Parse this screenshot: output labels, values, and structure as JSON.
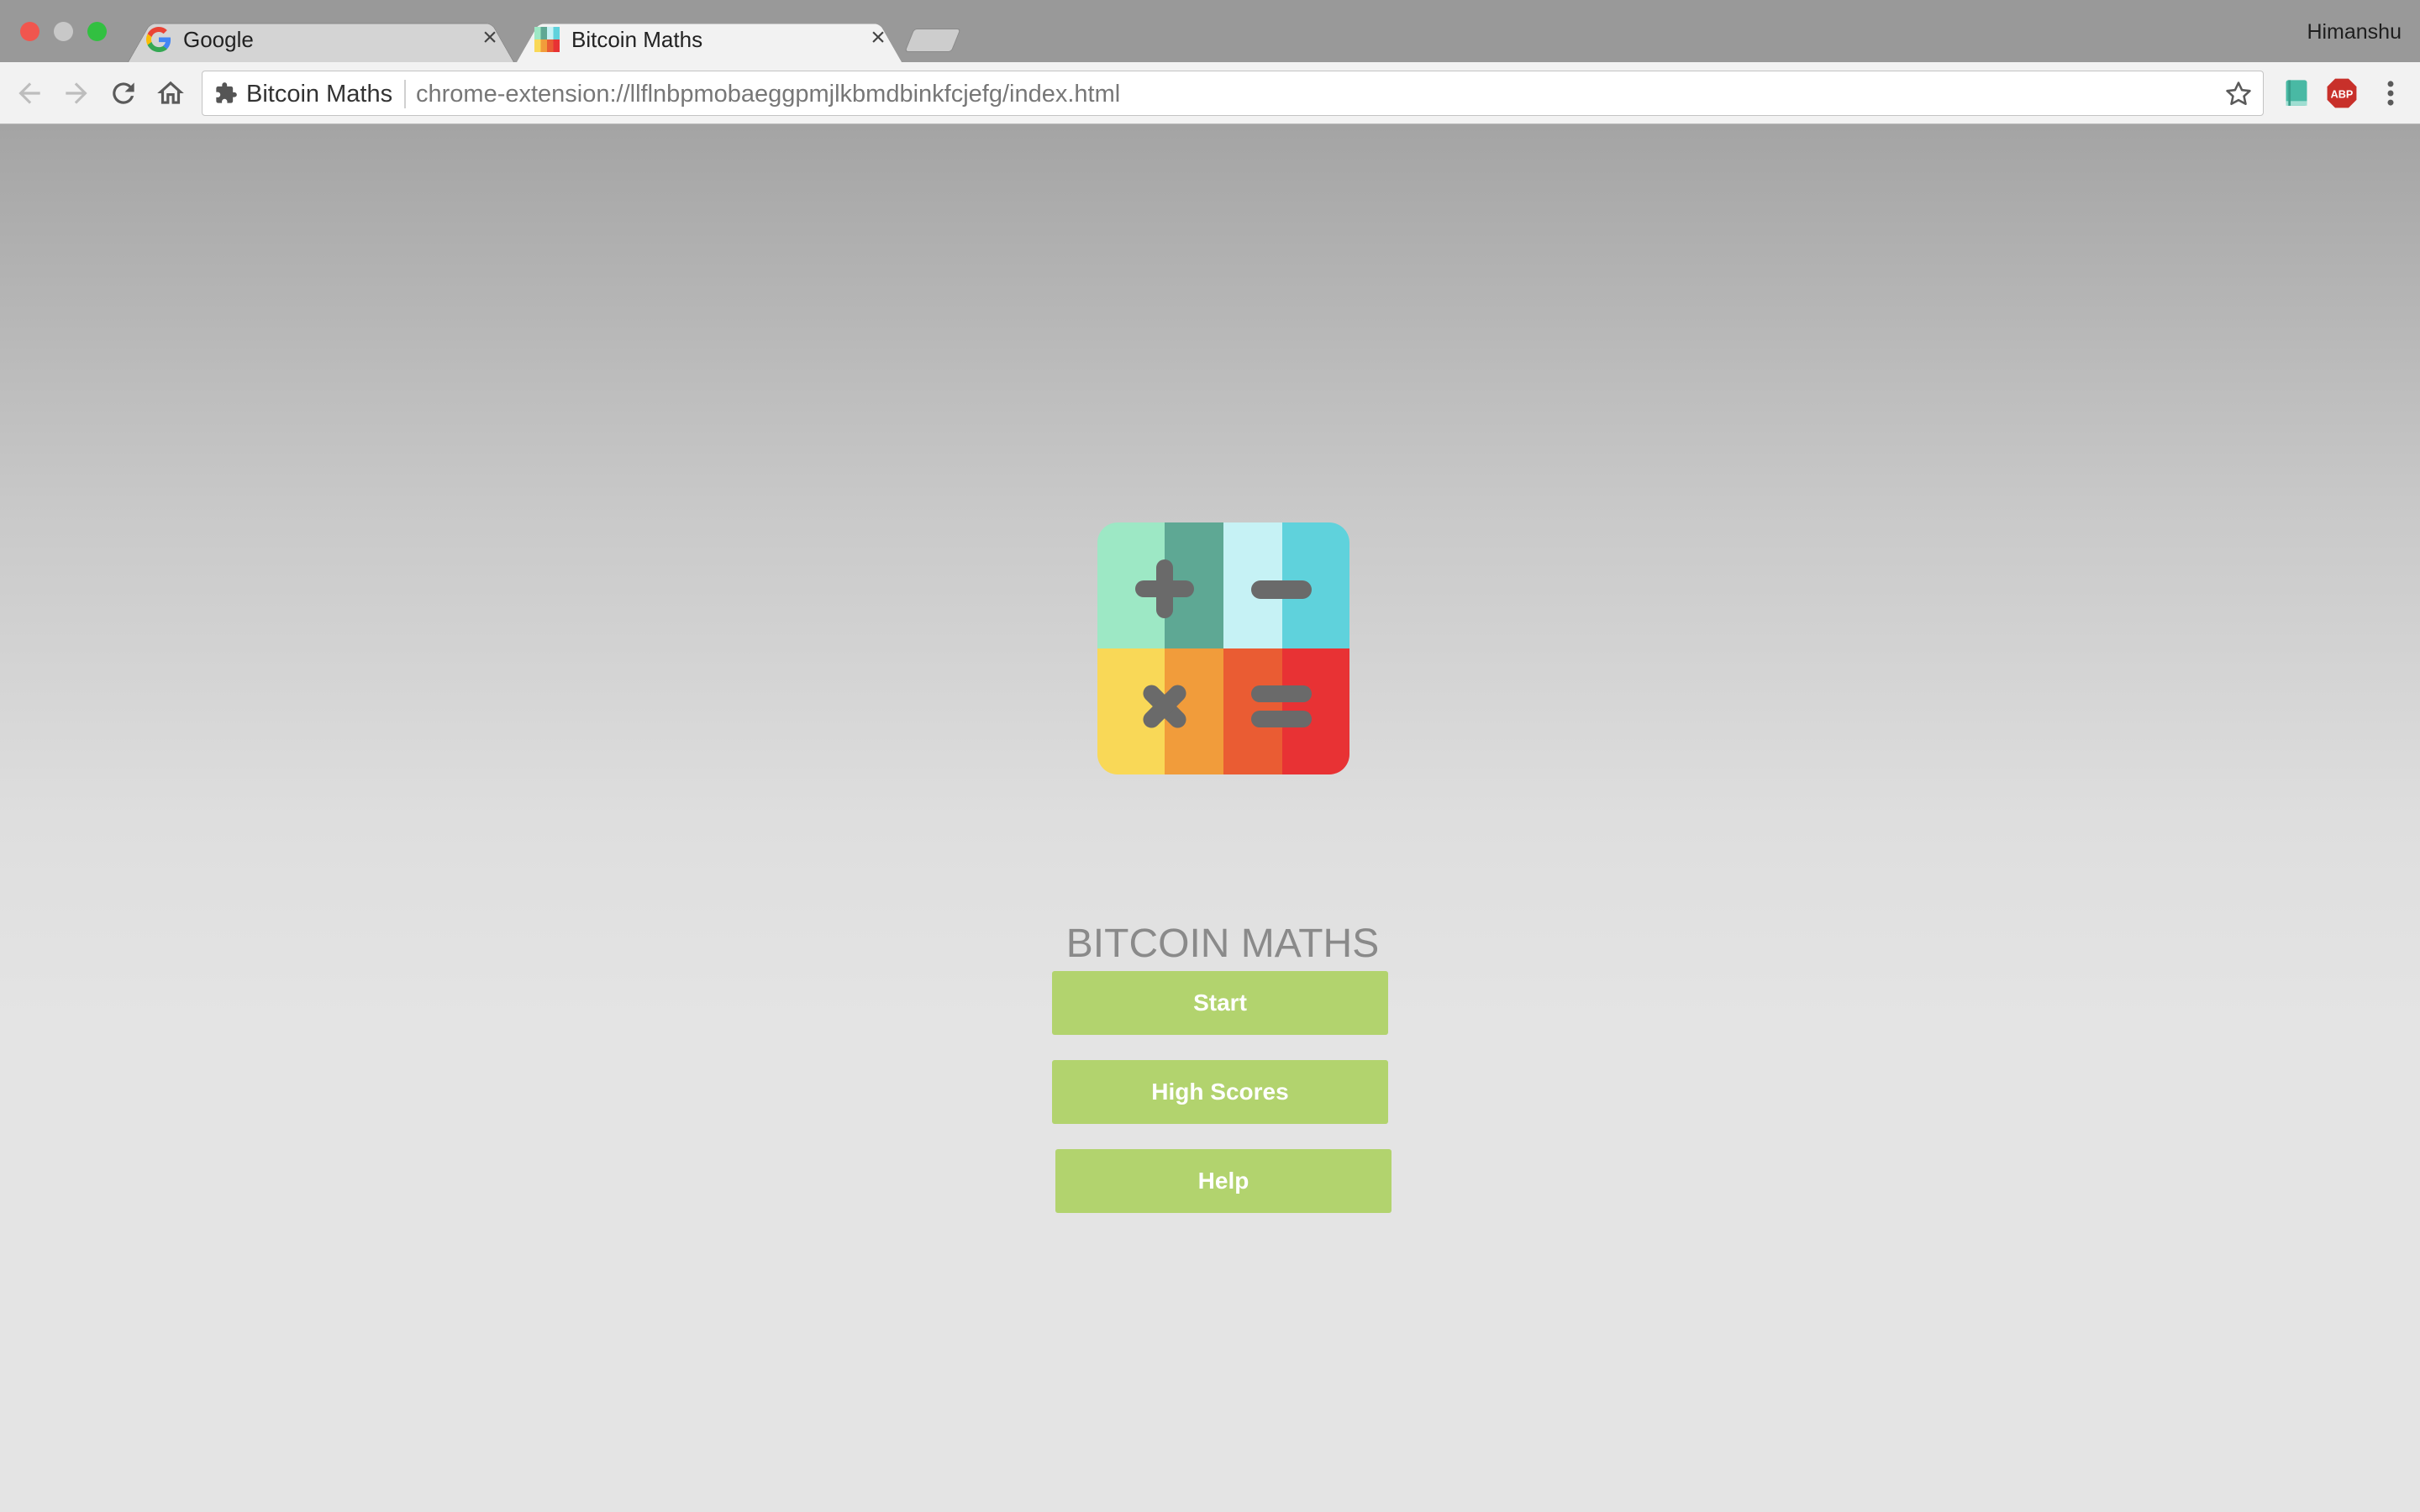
{
  "browser": {
    "profile_name": "Himanshu",
    "tabs": [
      {
        "title": "Google",
        "icon": "google-g-icon",
        "active": false
      },
      {
        "title": "Bitcoin Maths",
        "icon": "calculator-favicon",
        "active": true
      }
    ],
    "close_glyph": "×",
    "omnibox": {
      "site_label": "Bitcoin Maths",
      "url": "chrome-extension://llflnbpmobaeggpmjlkbmdbinkfcjefg/index.html"
    }
  },
  "app": {
    "title": "BITCOIN MATHS",
    "buttons": {
      "start": "Start",
      "high_scores": "High Scores",
      "help": "Help"
    },
    "logo_colors": {
      "plus_light": "#9de8c5",
      "plus_dark": "#5ea894",
      "minus_light": "#c6f2f5",
      "minus_dark": "#5fd2dc",
      "times_light": "#f9d857",
      "times_dark": "#f19c3b",
      "equals_light": "#ea5c33",
      "equals_dark": "#e83234",
      "symbol": "#6a6a6a"
    },
    "button_color": "#b2d36e"
  }
}
